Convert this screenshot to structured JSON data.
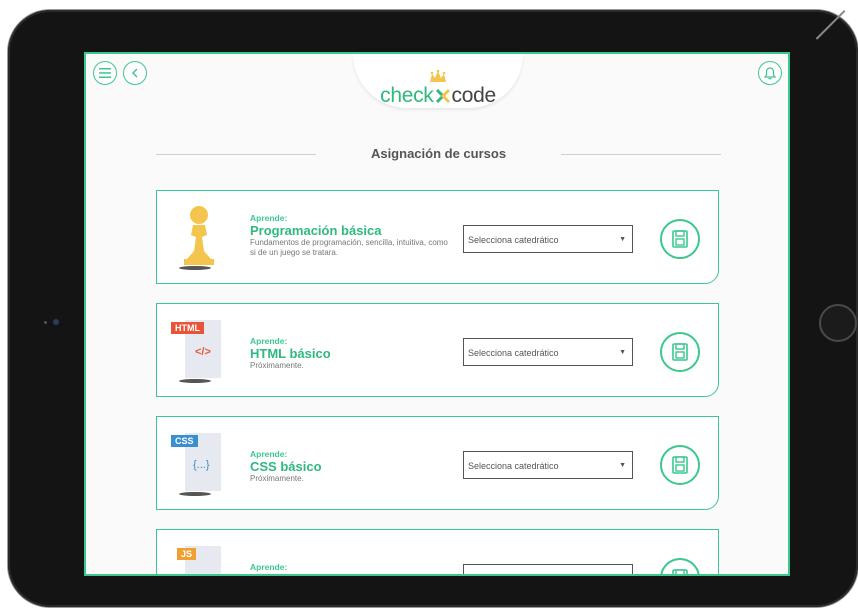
{
  "header": {
    "logo_part1": "check",
    "logo_part2": "code",
    "section_title": "Asignación de cursos"
  },
  "colors": {
    "accent": "#3cc78f",
    "html_badge": "#e8543a",
    "css_badge": "#3a8fd0",
    "js_badge": "#f0a030",
    "pawn": "#f3c54f"
  },
  "icons": {
    "menu": "hamburger-menu-icon",
    "back": "chevron-left-icon",
    "bell": "bell-icon",
    "save": "floppy-disk-icon",
    "crown": "crown-icon"
  },
  "courses": [
    {
      "learn_label": "Aprende:",
      "name": "Programación básica",
      "description": "Fundamentos de programación, sencilla, intuitiva, como si de un juego se tratara.",
      "select_placeholder": "Selecciona catedrático",
      "icon": "pawn-icon"
    },
    {
      "learn_label": "Aprende:",
      "name": "HTML básico",
      "description": "Próximamente.",
      "select_placeholder": "Selecciona catedrático",
      "icon": "html-file-icon",
      "badge": "HTML",
      "code": "</>"
    },
    {
      "learn_label": "Aprende:",
      "name": "CSS básico",
      "description": "Próximamente.",
      "select_placeholder": "Selecciona catedrático",
      "icon": "css-file-icon",
      "badge": "CSS",
      "code": "{...}"
    },
    {
      "learn_label": "Aprende:",
      "icon": "js-file-icon",
      "badge": "JS"
    }
  ]
}
